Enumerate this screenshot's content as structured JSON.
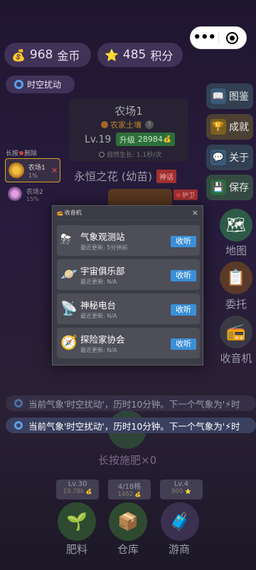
{
  "header": {
    "coins": "968",
    "coins_unit": "金币",
    "points": "485",
    "points_unit": "积分",
    "weather_badge": "时空扰动"
  },
  "farm": {
    "title": "农场1",
    "soil": "农家土壤",
    "soil_help": "?",
    "level": "Lv.19",
    "upgrade_label": "升级",
    "upgrade_cost": "28984",
    "growth": "自然生长: 1.1秒/次",
    "plant_name": "永恒之花 (幼苗)",
    "plant_tag": "神话",
    "protect_tag": "护卫"
  },
  "left_list": {
    "header": "长按",
    "header_action": "删除",
    "items": [
      {
        "name": "农场1",
        "pct": "1%",
        "remove": "✕"
      },
      {
        "name": "农场2",
        "pct": "15%"
      }
    ]
  },
  "right_buttons": [
    {
      "label": "图鉴",
      "icon": "book-icon"
    },
    {
      "label": "成就",
      "icon": "trophy-icon"
    },
    {
      "label": "关于",
      "icon": "chat-icon"
    },
    {
      "label": "保存",
      "icon": "save-icon"
    }
  ],
  "right_icons": [
    {
      "label": "地图",
      "icon": "map-icon"
    },
    {
      "label": "委托",
      "icon": "clipboard-icon"
    },
    {
      "label": "收音机",
      "icon": "radio-icon"
    }
  ],
  "modal": {
    "title": "收音机",
    "close": "×",
    "listen_label": "收听",
    "stations": [
      {
        "name": "气象观测站",
        "updated": "最近更新: 5分钟前",
        "icon": "weather-icon"
      },
      {
        "name": "宇宙俱乐部",
        "updated": "最近更新: N/A",
        "icon": "planet-icon"
      },
      {
        "name": "神秘电台",
        "updated": "最近更新: N/A",
        "icon": "satellite-dish-icon"
      },
      {
        "name": "探险家协会",
        "updated": "最近更新: N/A",
        "icon": "compass-icon"
      }
    ]
  },
  "tickers": [
    {
      "text": "当前气象'时空扰动'，历时10分钟。下一个气象为'⚡时"
    },
    {
      "text": "当前气象'时空扰动'，历时10分钟。下一个气象为'⚡时"
    }
  ],
  "fertilize_hint": "长按施肥×0",
  "bottom": [
    {
      "line1": "Lv.30",
      "line2": "19.78k",
      "label": "肥料",
      "icon": "sprout-icon"
    },
    {
      "line1": "4/18格",
      "line2": "1462",
      "label": "仓库",
      "icon": "box-icon"
    },
    {
      "line1": "Lv.4",
      "line2": "900",
      "label": "游商",
      "icon": "luggage-icon"
    }
  ],
  "colors": {
    "accent_blue": "#3a8fd8",
    "upgrade_green": "#2e6e3a",
    "myth_red": "#a03030"
  }
}
